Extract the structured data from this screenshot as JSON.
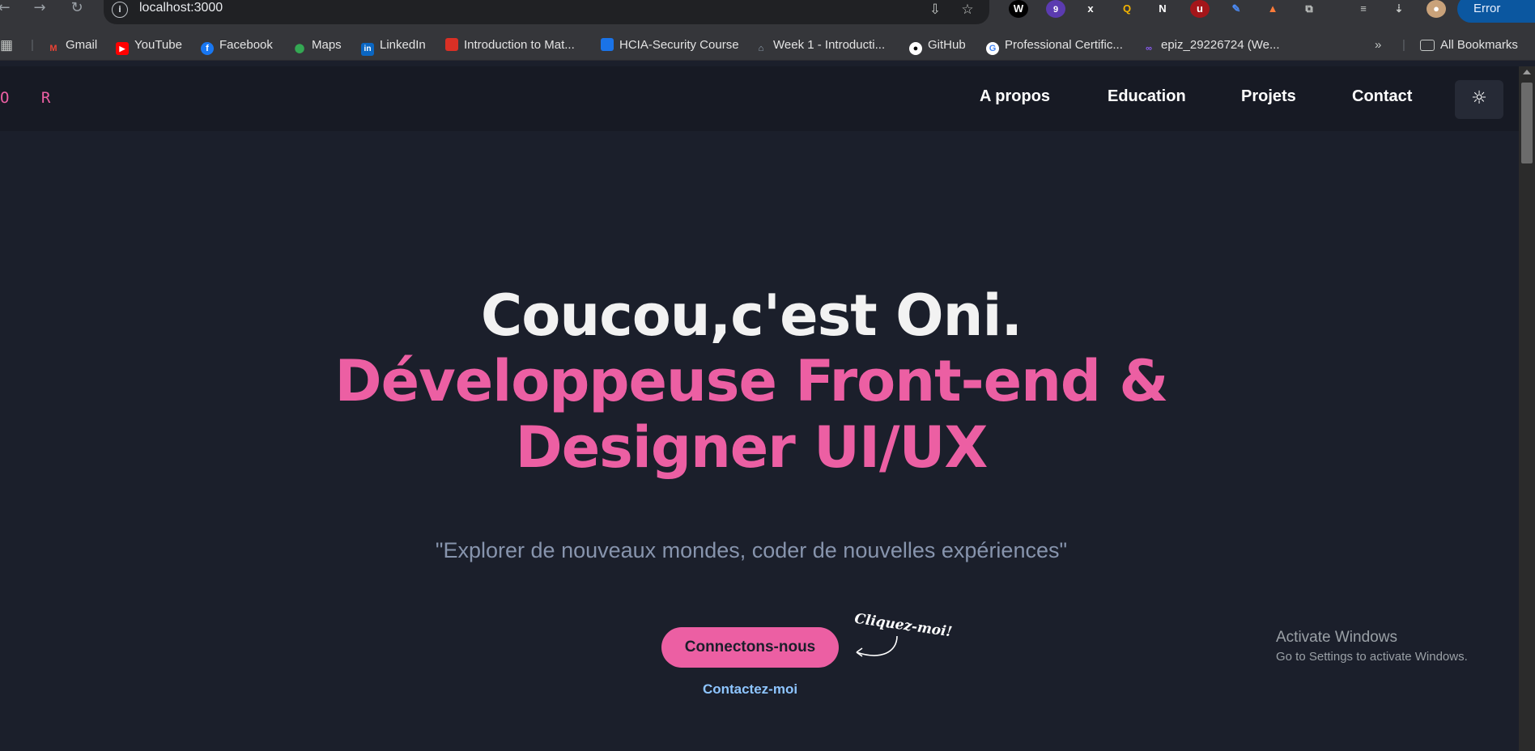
{
  "browser": {
    "url": "localhost:3000",
    "error_label": "Error",
    "extension_badge": "9",
    "bookmarks": [
      {
        "label": "Gmail",
        "icon": "gmail-icon"
      },
      {
        "label": "YouTube",
        "icon": "youtube-icon"
      },
      {
        "label": "Facebook",
        "icon": "facebook-icon"
      },
      {
        "label": "Maps",
        "icon": "maps-icon"
      },
      {
        "label": "LinkedIn",
        "icon": "linkedin-icon"
      },
      {
        "label": "Introduction to Mat...",
        "icon": "bookmark-red-icon"
      },
      {
        "label": "HCIA-Security Course",
        "icon": "bookmark-blue-icon"
      },
      {
        "label": "Week 1 - Introducti...",
        "icon": "course-icon"
      },
      {
        "label": "GitHub",
        "icon": "github-icon"
      },
      {
        "label": "Professional Certific...",
        "icon": "google-icon"
      },
      {
        "label": "epiz_29226724 (We...",
        "icon": "infinity-icon"
      }
    ],
    "all_bookmarks": "All Bookmarks"
  },
  "site": {
    "logo": "O R",
    "nav": [
      "A propos",
      "Education",
      "Projets",
      "Contact"
    ],
    "hero": {
      "line1": "Coucou,c'est Oni.",
      "line2": "Développeuse Front-end &",
      "line3": "Designer UI/UX",
      "quote": "\"Explorer de nouveaux mondes, coder de nouvelles expériences\""
    },
    "cta_label": "Connectons-nous",
    "cta_hint": "Cliquez-moi!",
    "contact_link": "Contactez-moi"
  },
  "windows_notice": {
    "title": "Activate Windows",
    "subtitle": "Go to Settings to activate Windows."
  },
  "colors": {
    "accent": "#ec5fa3",
    "background": "#1b1f2b",
    "link": "#8ec5ff"
  }
}
